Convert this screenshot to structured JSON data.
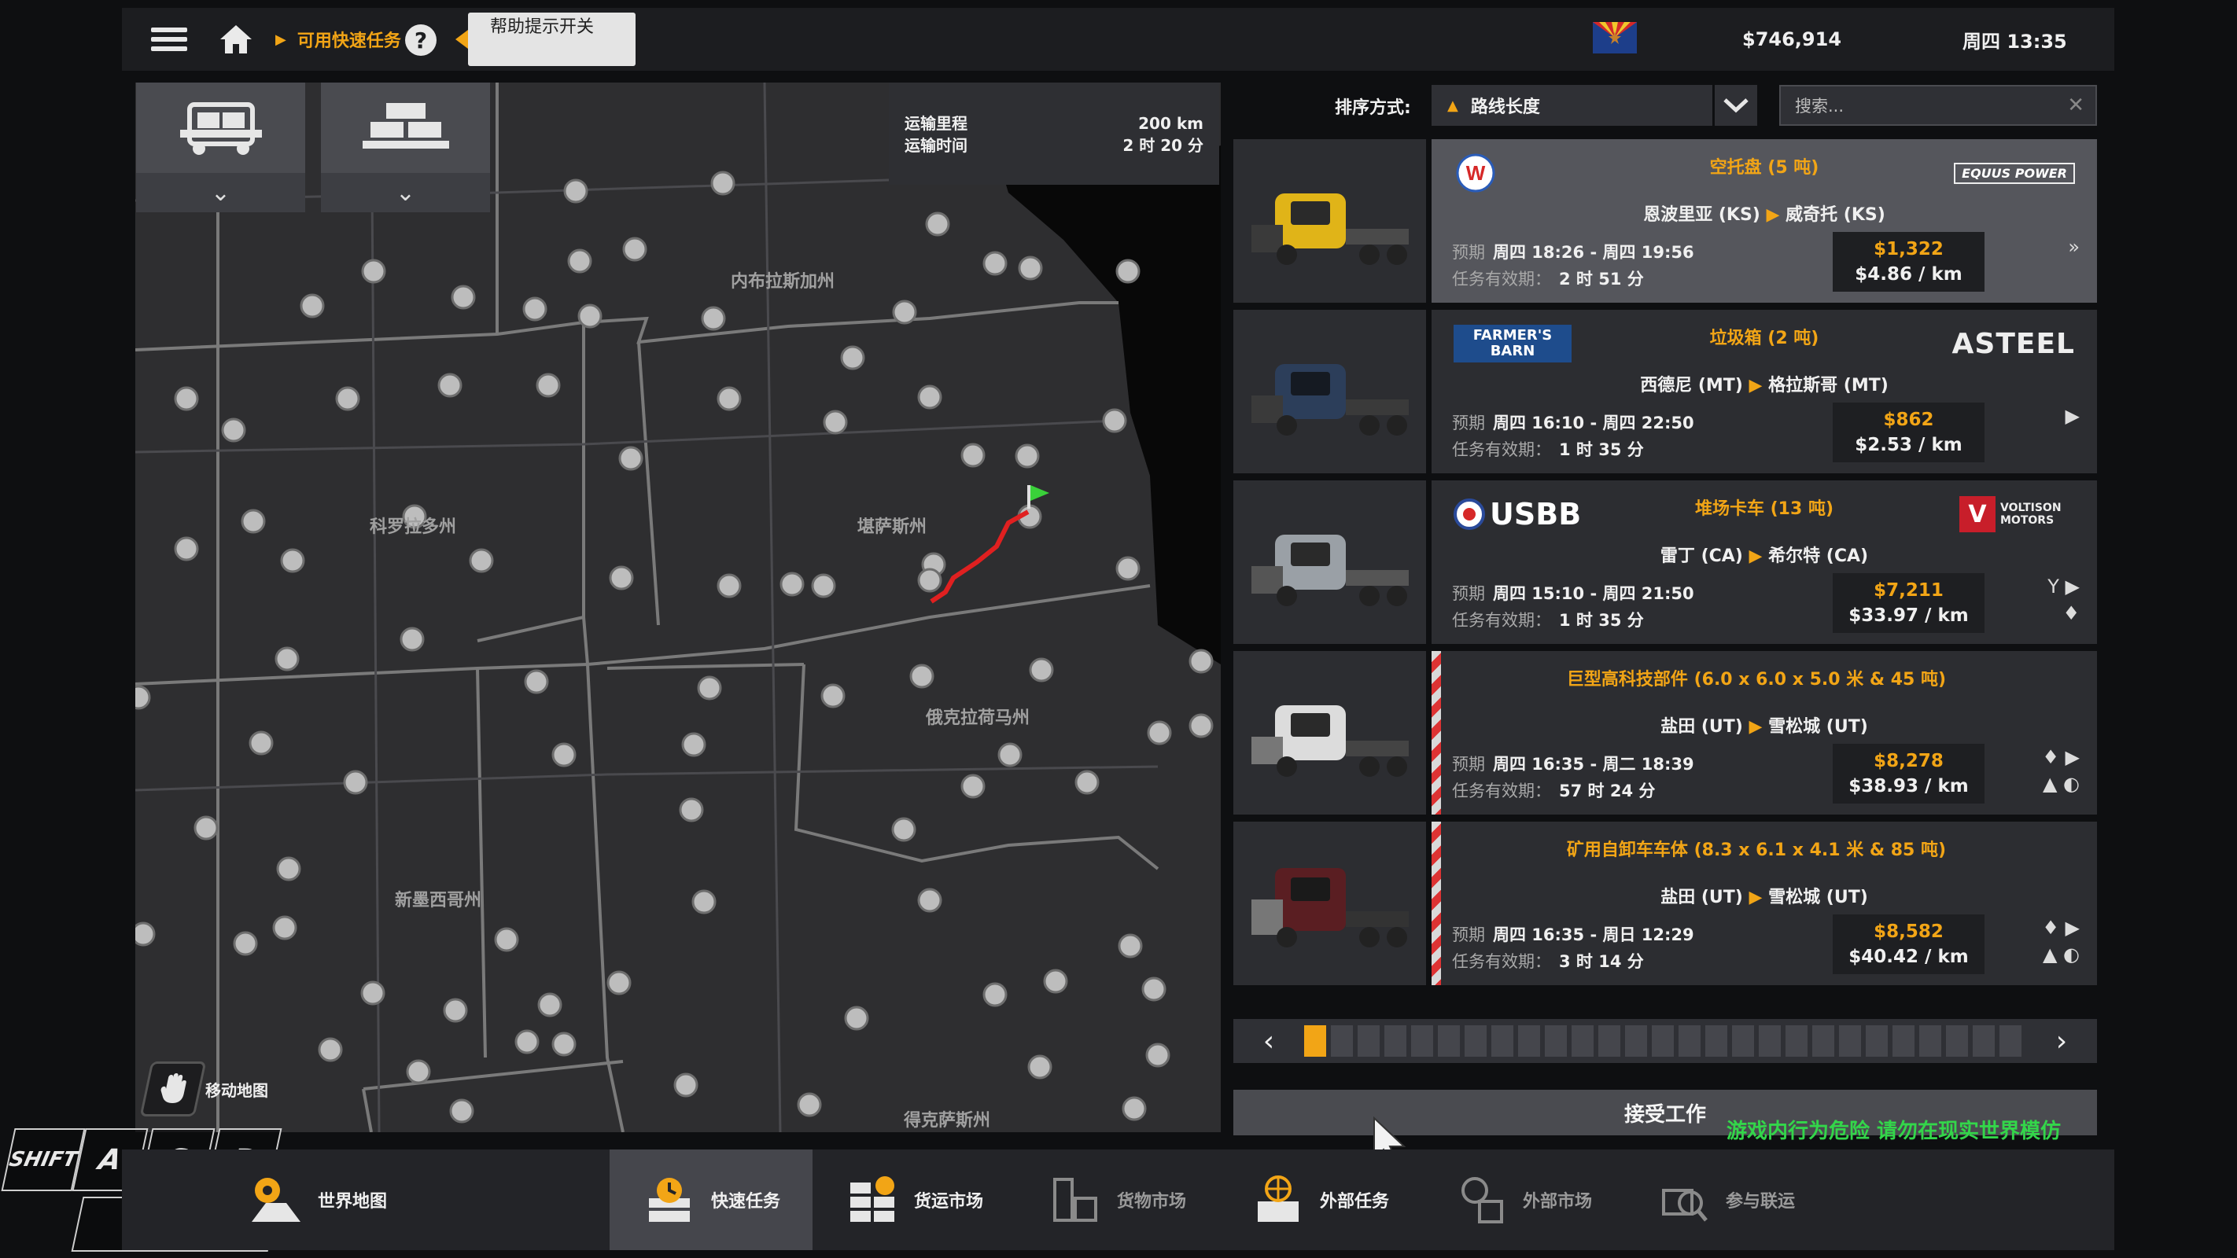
{
  "topbar": {
    "breadcrumb": "可用快速任务",
    "help_tip": "帮助提示开关",
    "money": "$746,914",
    "clock": "周四 13:35"
  },
  "map": {
    "route_info": {
      "distance_label": "运输里程",
      "distance_value": "200 km",
      "time_label": "运输时间",
      "time_value": "2 时 20 分"
    },
    "states": [
      "内布拉斯加州",
      "科罗拉多州",
      "堪萨斯州",
      "俄克拉荷马州",
      "新墨西哥州",
      "得克萨斯州"
    ],
    "move_map_label": "移动地图",
    "colors": {
      "route": "#e02020",
      "flag": "#3ad13a",
      "city": "#bdbdbd",
      "border": "#7a7a7a",
      "land": "#2e2e30"
    }
  },
  "keys": [
    "SHIFT",
    "A",
    "S",
    "D"
  ],
  "sort": {
    "label": "排序方式:",
    "value": "路线长度",
    "search_placeholder": "搜索..."
  },
  "jobs": [
    {
      "cargo": "空托盘 (5 吨)",
      "from": "恩波里亚 (KS)",
      "to": "威奇托 (KS)",
      "eta_label": "预期",
      "eta": "周四 18:26 - 周四 19:56",
      "valid_label": "任务有效期：",
      "valid": "2 时 51 分",
      "total": "$1,322",
      "per_km": "$4.86 / km",
      "company_left": "W",
      "company_right": "EQUUS POWER",
      "truck_color": "#e0b418",
      "selected": true
    },
    {
      "cargo": "垃圾箱 (2 吨)",
      "from": "西德尼 (MT)",
      "to": "格拉斯哥 (MT)",
      "eta_label": "预期",
      "eta": "周四 16:10 - 周四 22:50",
      "valid_label": "任务有效期：",
      "valid": "1 时 35 分",
      "total": "$862",
      "per_km": "$2.53 / km",
      "company_left": "FARMER'S BARN",
      "company_right": "ASTEEL",
      "truck_color": "#2c3e5a",
      "selected": false
    },
    {
      "cargo": "堆场卡车 (13 吨)",
      "from": "雷丁 (CA)",
      "to": "希尔特 (CA)",
      "eta_label": "预期",
      "eta": "周四 15:10 - 周四 21:50",
      "valid_label": "任务有效期：",
      "valid": "1 时 35 分",
      "total": "$7,211",
      "per_km": "$33.97 / km",
      "company_left": "USBB",
      "company_right": "VOLTISON MOTORS",
      "truck_color": "#9aa0a6",
      "selected": false
    },
    {
      "cargo": "巨型高科技部件 (6.0 x 6.0 x 5.0 米 & 45 吨)",
      "from": "盐田 (UT)",
      "to": "雪松城 (UT)",
      "eta_label": "预期",
      "eta": "周四 16:35 - 周二 18:39",
      "valid_label": "任务有效期：",
      "valid": "57 时 24 分",
      "total": "$8,278",
      "per_km": "$38.93 / km",
      "truck_color": "#dcdcdc",
      "selected": false
    },
    {
      "cargo": "矿用自卸车车体 (8.3 x 6.1 x 4.1 米 & 85 吨)",
      "from": "盐田 (UT)",
      "to": "雪松城 (UT)",
      "eta_label": "预期",
      "eta": "周四 16:35 - 周日 12:29",
      "valid_label": "任务有效期：",
      "valid": "3 时 14 分",
      "total": "$8,582",
      "per_km": "$40.42 / km",
      "truck_color": "#5a1e22",
      "selected": false
    }
  ],
  "pager": {
    "current": 1,
    "total": 27
  },
  "accept_label": "接受工作",
  "warning": "游戏内行为危险 请勿在现实世界模仿",
  "nav": [
    {
      "label": "世界地图",
      "icon": "world-map-icon",
      "active": false,
      "dim": false
    },
    {
      "label": "快速任务",
      "icon": "quick-job-icon",
      "active": true,
      "dim": false
    },
    {
      "label": "货运市场",
      "icon": "freight-market-icon",
      "active": false,
      "dim": false
    },
    {
      "label": "货物市场",
      "icon": "cargo-market-icon",
      "active": false,
      "dim": true
    },
    {
      "label": "外部任务",
      "icon": "external-contracts-icon",
      "active": false,
      "dim": false
    },
    {
      "label": "外部市场",
      "icon": "external-market-icon",
      "active": false,
      "dim": true
    },
    {
      "label": "参与联运",
      "icon": "convoy-icon",
      "active": false,
      "dim": true
    }
  ]
}
